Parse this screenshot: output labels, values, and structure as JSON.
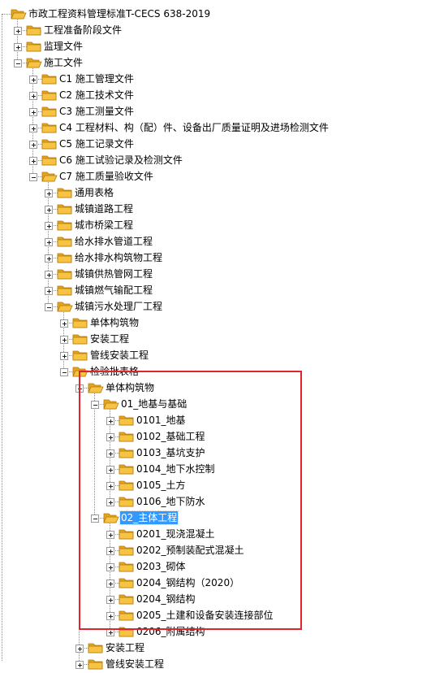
{
  "tree": {
    "selected_label": "02_主体工程",
    "nodes": [
      {
        "label": "市政工程资料管理标准T-CECS 638-2019",
        "depth": 0,
        "state": "expanded",
        "icon": "folder-open-icon"
      },
      {
        "label": "工程准备阶段文件",
        "depth": 1,
        "state": "collapsed",
        "icon": "folder-icon"
      },
      {
        "label": "监理文件",
        "depth": 1,
        "state": "collapsed",
        "icon": "folder-icon"
      },
      {
        "label": "施工文件",
        "depth": 1,
        "state": "expanded",
        "icon": "folder-open-icon"
      },
      {
        "label": "C1 施工管理文件",
        "depth": 2,
        "state": "collapsed",
        "icon": "folder-icon"
      },
      {
        "label": "C2 施工技术文件",
        "depth": 2,
        "state": "collapsed",
        "icon": "folder-icon"
      },
      {
        "label": "C3 施工测量文件",
        "depth": 2,
        "state": "collapsed",
        "icon": "folder-icon"
      },
      {
        "label": "C4 工程材料、构（配）件、设备出厂质量证明及进场检测文件",
        "depth": 2,
        "state": "collapsed",
        "icon": "folder-icon"
      },
      {
        "label": "C5 施工记录文件",
        "depth": 2,
        "state": "collapsed",
        "icon": "folder-icon"
      },
      {
        "label": "C6 施工试验记录及检测文件",
        "depth": 2,
        "state": "collapsed",
        "icon": "folder-icon"
      },
      {
        "label": "C7 施工质量验收文件",
        "depth": 2,
        "state": "expanded",
        "icon": "folder-open-icon"
      },
      {
        "label": "通用表格",
        "depth": 3,
        "state": "collapsed",
        "icon": "folder-icon"
      },
      {
        "label": "城镇道路工程",
        "depth": 3,
        "state": "collapsed",
        "icon": "folder-icon"
      },
      {
        "label": "城市桥梁工程",
        "depth": 3,
        "state": "collapsed",
        "icon": "folder-icon"
      },
      {
        "label": "给水排水管道工程",
        "depth": 3,
        "state": "collapsed",
        "icon": "folder-icon"
      },
      {
        "label": "给水排水构筑物工程",
        "depth": 3,
        "state": "collapsed",
        "icon": "folder-icon"
      },
      {
        "label": "城镇供热管网工程",
        "depth": 3,
        "state": "collapsed",
        "icon": "folder-icon"
      },
      {
        "label": "城镇燃气输配工程",
        "depth": 3,
        "state": "collapsed",
        "icon": "folder-icon"
      },
      {
        "label": "城镇污水处理厂工程",
        "depth": 3,
        "state": "expanded",
        "icon": "folder-open-icon"
      },
      {
        "label": "单体构筑物",
        "depth": 4,
        "state": "collapsed",
        "icon": "folder-icon"
      },
      {
        "label": "安装工程",
        "depth": 4,
        "state": "collapsed",
        "icon": "folder-icon"
      },
      {
        "label": "管线安装工程",
        "depth": 4,
        "state": "collapsed",
        "icon": "folder-icon"
      },
      {
        "label": "检验批表格",
        "depth": 4,
        "state": "expanded",
        "icon": "folder-open-icon"
      },
      {
        "label": "单体构筑物",
        "depth": 5,
        "state": "expanded",
        "icon": "folder-open-icon"
      },
      {
        "label": "01_地基与基础",
        "depth": 6,
        "state": "expanded",
        "icon": "folder-open-icon"
      },
      {
        "label": "0101_地基",
        "depth": 7,
        "state": "collapsed",
        "icon": "folder-icon"
      },
      {
        "label": "0102_基础工程",
        "depth": 7,
        "state": "collapsed",
        "icon": "folder-icon"
      },
      {
        "label": "0103_基坑支护",
        "depth": 7,
        "state": "collapsed",
        "icon": "folder-icon"
      },
      {
        "label": "0104_地下水控制",
        "depth": 7,
        "state": "collapsed",
        "icon": "folder-icon"
      },
      {
        "label": "0105_土方",
        "depth": 7,
        "state": "collapsed",
        "icon": "folder-icon"
      },
      {
        "label": "0106_地下防水",
        "depth": 7,
        "state": "collapsed",
        "icon": "folder-icon"
      },
      {
        "label": "02_主体工程",
        "depth": 6,
        "state": "expanded",
        "icon": "folder-open-icon",
        "selected": true
      },
      {
        "label": "0201_现浇混凝土",
        "depth": 7,
        "state": "collapsed",
        "icon": "folder-icon"
      },
      {
        "label": "0202_预制装配式混凝土",
        "depth": 7,
        "state": "collapsed",
        "icon": "folder-icon"
      },
      {
        "label": "0203_砌体",
        "depth": 7,
        "state": "collapsed",
        "icon": "folder-icon"
      },
      {
        "label": "0204_钢结构（2020）",
        "depth": 7,
        "state": "collapsed",
        "icon": "folder-icon"
      },
      {
        "label": "0204_钢结构",
        "depth": 7,
        "state": "collapsed",
        "icon": "folder-icon"
      },
      {
        "label": "0205_土建和设备安装连接部位",
        "depth": 7,
        "state": "collapsed",
        "icon": "folder-icon"
      },
      {
        "label": "0206_附属结构",
        "depth": 7,
        "state": "collapsed",
        "icon": "folder-icon"
      },
      {
        "label": "安装工程",
        "depth": 5,
        "state": "collapsed",
        "icon": "folder-icon"
      },
      {
        "label": "管线安装工程",
        "depth": 5,
        "state": "collapsed",
        "icon": "folder-icon"
      }
    ]
  },
  "colors": {
    "folder_body": "#f6c343",
    "folder_back": "#e4a51e",
    "selection": "#3399ff",
    "highlight_box": "#e0242c"
  }
}
